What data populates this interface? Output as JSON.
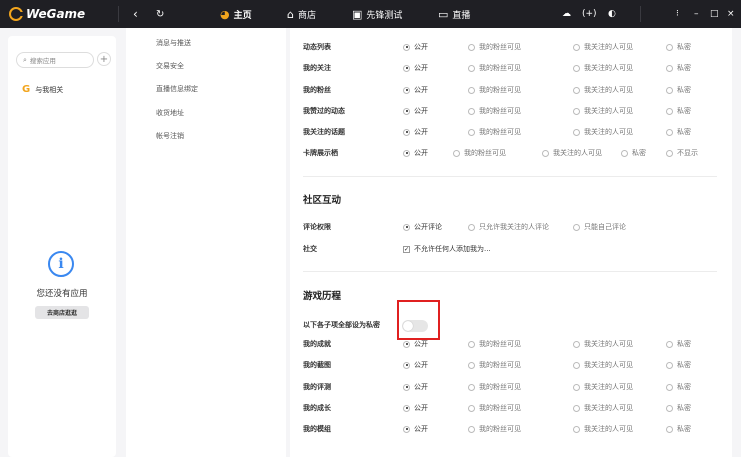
{
  "titlebar": {
    "logo": "WeGame",
    "nav": [
      {
        "label": "主页",
        "icon": "home-icon"
      },
      {
        "label": "商店",
        "icon": "store-icon"
      },
      {
        "label": "先锋测试",
        "icon": "test-icon"
      },
      {
        "label": "直播",
        "icon": "live-icon"
      }
    ],
    "download_label": "(+)"
  },
  "sidebar": {
    "search_placeholder": "搜索应用",
    "related_label": "与我相关",
    "empty_text": "您还没有应用",
    "store_button": "去商店逛逛"
  },
  "menu": {
    "items": [
      "消息与推送",
      "交易安全",
      "直播信息绑定",
      "收货地址",
      "帐号注销"
    ]
  },
  "privacy": {
    "options": [
      "公开",
      "我的粉丝可见",
      "我关注的人可见",
      "私密"
    ],
    "card_options": [
      "公开",
      "我的粉丝可见",
      "我关注的人可见",
      "私密",
      "不显示"
    ],
    "rows": [
      "动态列表",
      "我的关注",
      "我的粉丝",
      "我赞过的动态",
      "我关注的话题"
    ],
    "card_row": "卡牌展示栖"
  },
  "community": {
    "title": "社区互动",
    "comment_label": "评论权限",
    "comment_options": [
      "公开评论",
      "只允许我关注的人评论",
      "只能自己评论"
    ],
    "social_label": "社交",
    "social_check": "不允许任何人添加我为..."
  },
  "history": {
    "title": "游戏历程",
    "toggle_label": "以下各子项全部设为私密",
    "toggle_on": false,
    "rows": [
      "我的成就",
      "我的截图",
      "我的评测",
      "我的成长",
      "我的模组"
    ]
  }
}
